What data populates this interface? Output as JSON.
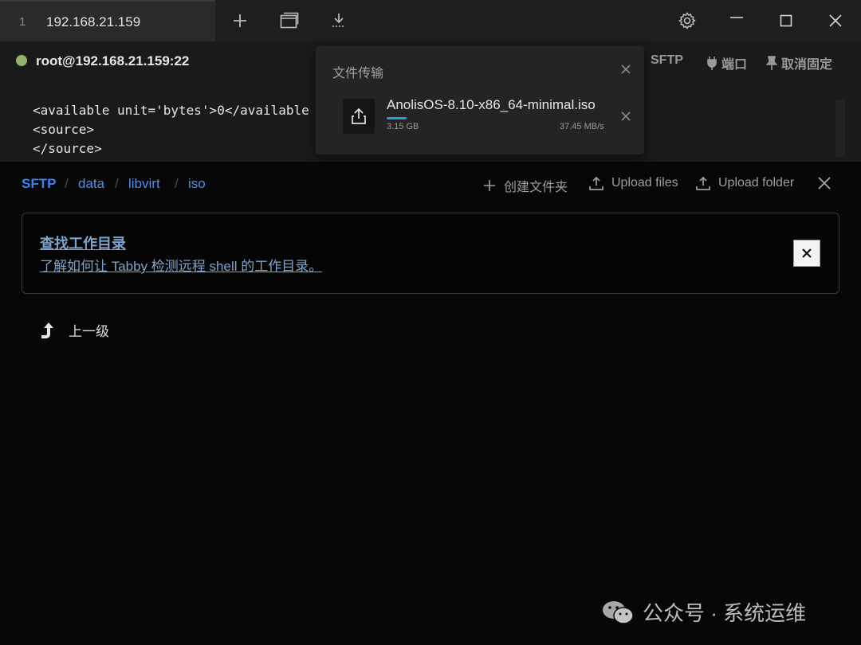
{
  "tab": {
    "index": "1",
    "title": "192.168.21.159"
  },
  "terminal": {
    "host": "root@192.168.21.159:22",
    "actions": {
      "sftp": "SFTP",
      "ports": "端口",
      "unpin": "取消固定"
    },
    "lines": [
      "<available unit='bytes'>0</available",
      "<source>",
      "</source>"
    ]
  },
  "transfer": {
    "title": "文件传输",
    "file_name": "AnolisOS-8.10-x86_64-minimal.iso",
    "size": "3.15 GB",
    "speed": "37.45 MB/s",
    "progress_percent": 9
  },
  "sftp": {
    "breadcrumb": [
      "SFTP",
      "data",
      "libvirt",
      "iso"
    ],
    "separator": "/",
    "actions": {
      "new_folder": "创建文件夹",
      "upload_files": "Upload files",
      "upload_folder": "Upload folder"
    },
    "alert": {
      "title": "查找工作目录",
      "desc": "了解如何让 Tabby 检测远程 shell 的工作目录。"
    },
    "parent_dir": "上一级"
  },
  "watermark": {
    "text": "公众号 · 系统运维"
  },
  "colors": {
    "accent": "#3d82f0",
    "progress": "#19a7d9",
    "status": "#8fb36b"
  }
}
